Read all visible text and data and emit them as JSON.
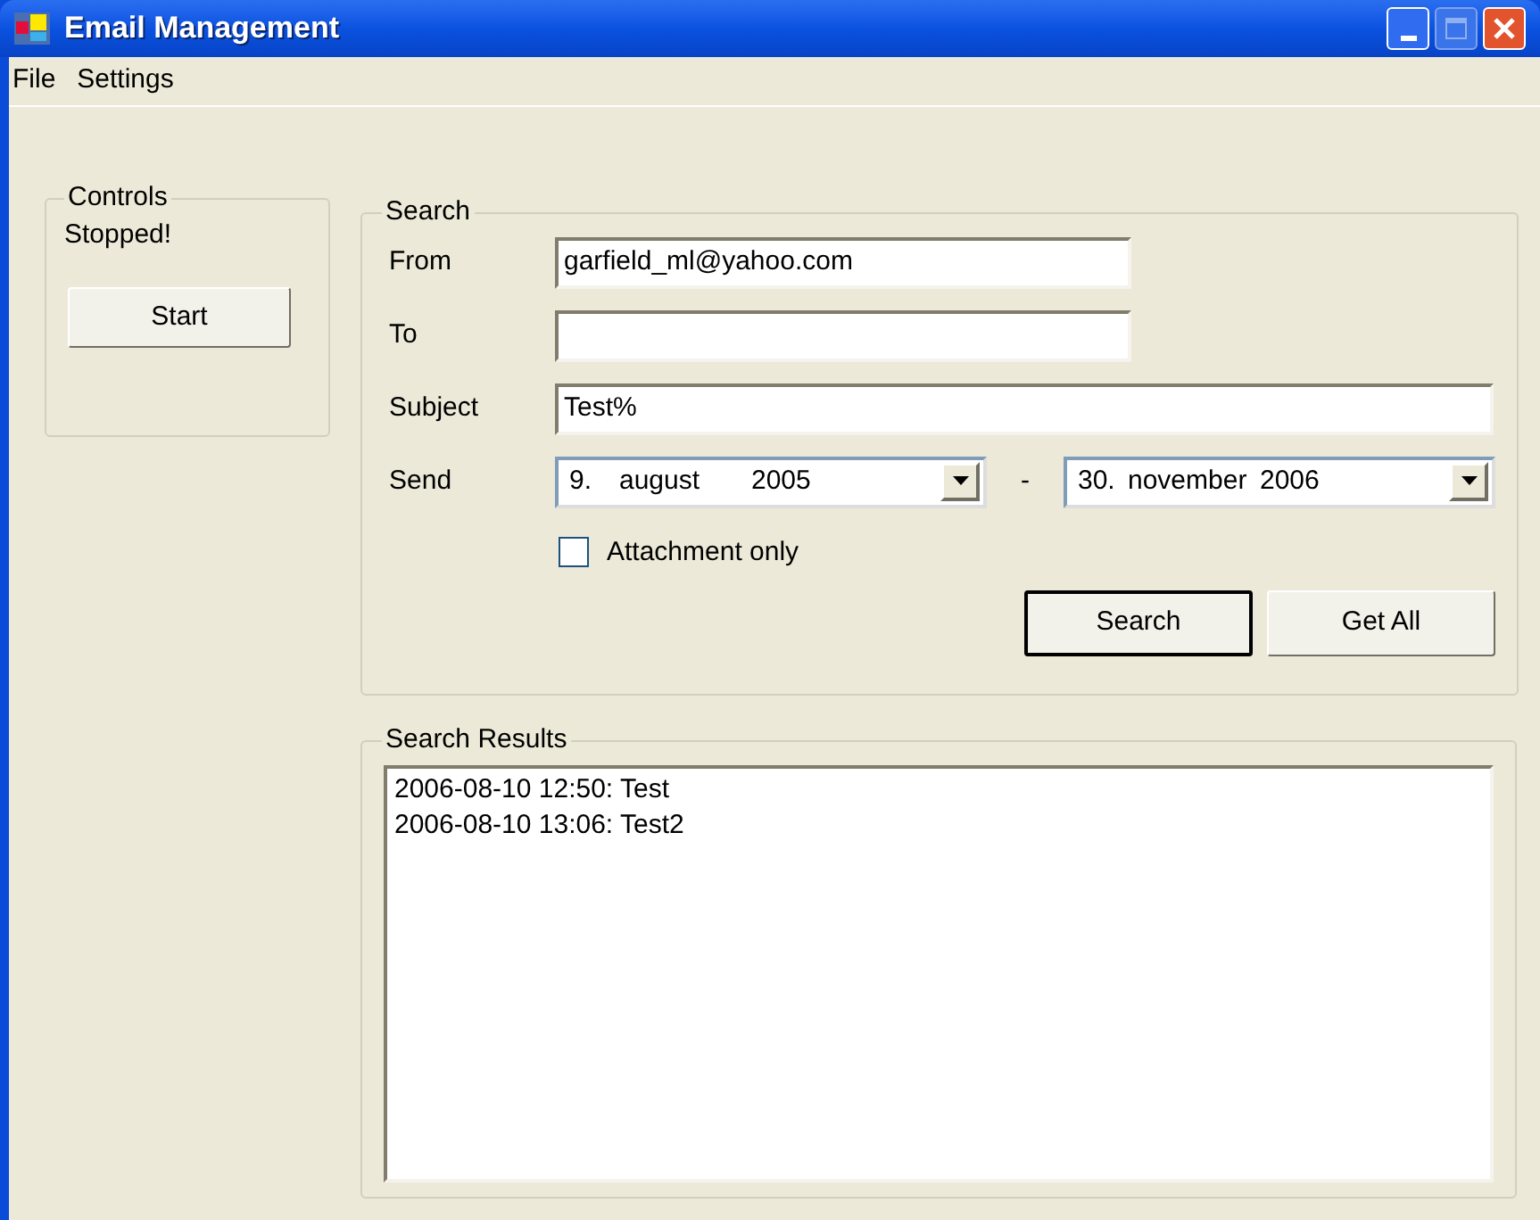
{
  "window": {
    "title": "Email Management"
  },
  "menu": [
    {
      "label": "File"
    },
    {
      "label": "Settings"
    }
  ],
  "controls": {
    "title": "Controls",
    "status": "Stopped!",
    "button": "Start"
  },
  "search": {
    "title": "Search",
    "fields": [
      {
        "label": "From",
        "value": "garfield_ml@yahoo.com",
        "wide": false
      },
      {
        "label": "To",
        "wide": false
      },
      {
        "label": "Subject",
        "value": "Test%",
        "wide": true
      }
    ],
    "send": {
      "label": "Send",
      "from": [
        "9.",
        "august",
        "2005"
      ],
      "separator": "-",
      "to": [
        "30.",
        "november",
        "2006"
      ]
    },
    "checkbox": {
      "label": "Attachment only",
      "checked": false
    },
    "buttons": [
      {
        "label": "Search",
        "default": true
      },
      {
        "label": "Get All",
        "default": false
      }
    ]
  },
  "results": {
    "title": "Search Results",
    "items": [
      "2006-08-10 12:50: Test",
      "2006-08-10 13:06: Test2"
    ]
  }
}
